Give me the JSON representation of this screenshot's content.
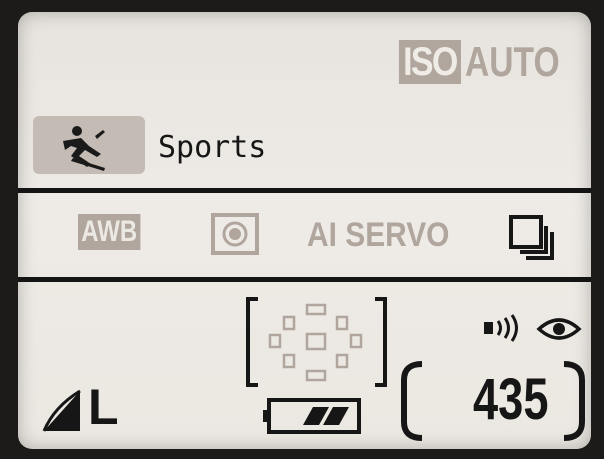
{
  "iso": {
    "label": "ISO",
    "value": "AUTO"
  },
  "shooting_mode": {
    "icon": "sports-skier-icon",
    "label": "Sports"
  },
  "white_balance": {
    "label": "AWB"
  },
  "metering": {
    "icon": "evaluative-metering-icon"
  },
  "af_operation": {
    "label": "AI SERVO"
  },
  "drive_mode": {
    "icon": "continuous-shooting-icon"
  },
  "af_point_selection": {
    "icon": "af-points-automatic-icon"
  },
  "beep": {
    "icon": "beep-on-icon"
  },
  "red_eye": {
    "icon": "red-eye-reduction-icon"
  },
  "image_quality": {
    "icon": "large-fine-icon",
    "label": "L"
  },
  "battery": {
    "icon": "battery-icon",
    "level": 0.66
  },
  "shots_remaining": {
    "value": "435"
  },
  "colors": {
    "lcd_bg": "#ebe7e1",
    "dim_text": "#b0a69d",
    "dark_text": "#161616",
    "highlight": "#c4bcb4"
  }
}
